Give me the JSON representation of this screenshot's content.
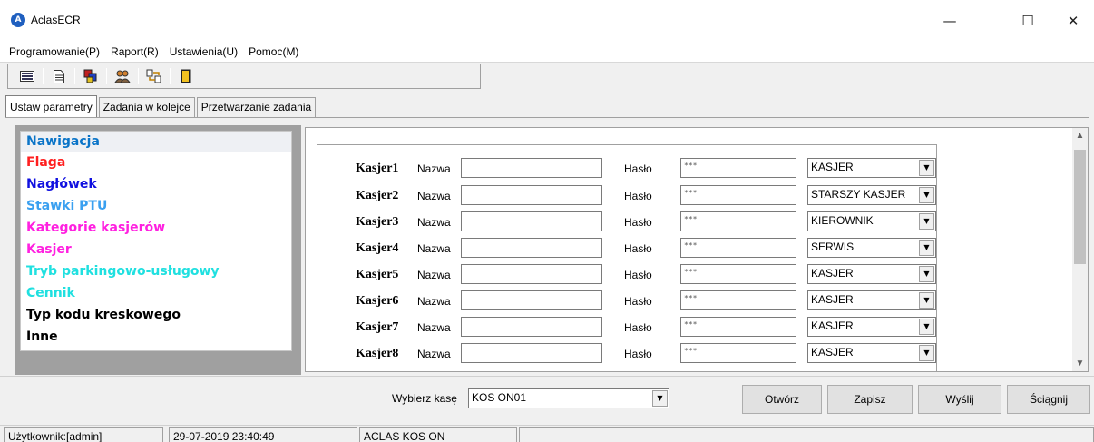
{
  "window": {
    "title": "AclasECR",
    "minimize": "—",
    "maximize": "☐",
    "close": "✕"
  },
  "menu": [
    "Programowanie(P)",
    "Raport(R)",
    "Ustawienia(U)",
    "Pomoc(M)"
  ],
  "tabs": [
    "Ustaw parametry",
    "Zadania w kolejce",
    "Przetwarzanie zadania"
  ],
  "navigation": {
    "header": "Nawigacja",
    "items": [
      {
        "label": "Flaga",
        "color": "#ff2020"
      },
      {
        "label": "Nagłówek",
        "color": "#1010e0"
      },
      {
        "label": "Stawki PTU",
        "color": "#3aa0f0"
      },
      {
        "label": "Kategorie kasjerów",
        "color": "#ff20e0"
      },
      {
        "label": "Kasjer",
        "color": "#ff20e0"
      },
      {
        "label": "Tryb parkingowo-usługowy",
        "color": "#20e0e0"
      },
      {
        "label": "Cennik",
        "color": "#20e0e0"
      },
      {
        "label": "Typ kodu kreskowego",
        "color": "#000000"
      },
      {
        "label": "Inne",
        "color": "#000000"
      }
    ]
  },
  "form": {
    "name_label": "Nazwa",
    "password_label": "Hasło",
    "cashiers": [
      {
        "label": "Kasjer1",
        "name": "",
        "password": "***",
        "role": "KASJER"
      },
      {
        "label": "Kasjer2",
        "name": "",
        "password": "***",
        "role": "STARSZY KASJER"
      },
      {
        "label": "Kasjer3",
        "name": "",
        "password": "***",
        "role": "KIEROWNIK"
      },
      {
        "label": "Kasjer4",
        "name": "",
        "password": "***",
        "role": "SERWIS"
      },
      {
        "label": "Kasjer5",
        "name": "",
        "password": "***",
        "role": "KASJER"
      },
      {
        "label": "Kasjer6",
        "name": "",
        "password": "***",
        "role": "KASJER"
      },
      {
        "label": "Kasjer7",
        "name": "",
        "password": "***",
        "role": "KASJER"
      },
      {
        "label": "Kasjer8",
        "name": "",
        "password": "***",
        "role": "KASJER"
      }
    ]
  },
  "bottom": {
    "select_label": "Wybierz kasę",
    "select_value": "KOS ON01",
    "buttons": {
      "open": "Otwórz",
      "save": "Zapisz",
      "send": "Wyślij",
      "download": "Ściągnij"
    }
  },
  "status": {
    "user": "Użytkownik:[admin]",
    "datetime": "29-07-2019 23:40:49",
    "device": "ACLAS KOS ON",
    "extra": ""
  }
}
